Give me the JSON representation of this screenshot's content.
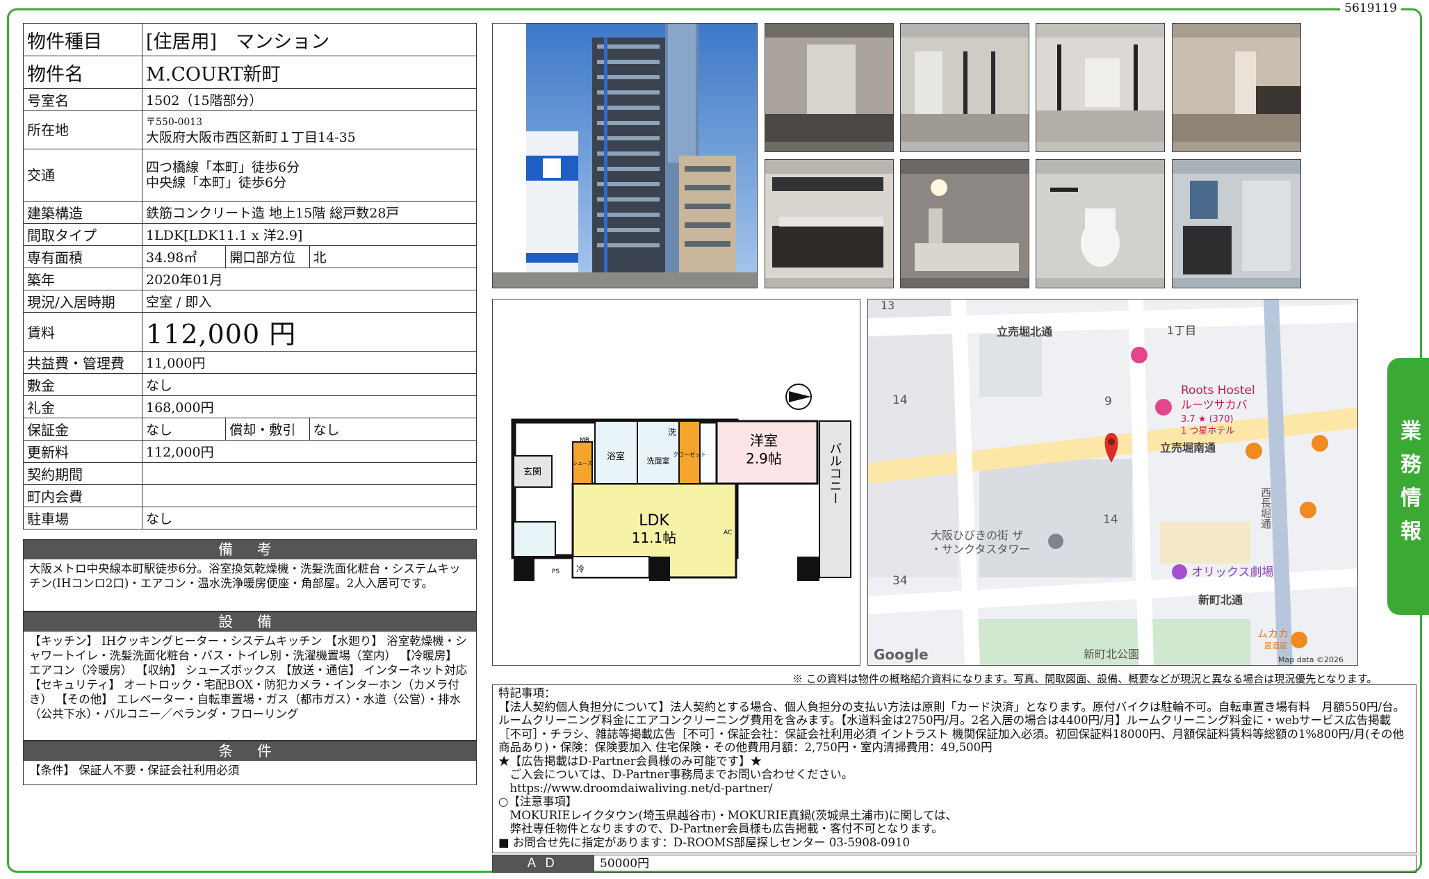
{
  "doc_id": "5619119",
  "side_tab": "業務情報",
  "property": {
    "type_label": "物件種目",
    "type_value": "[住居用]　マンション",
    "name_label": "物件名",
    "name_value": "M.COURT新町",
    "room_label": "号室名",
    "room_value": "1502（15階部分）",
    "address_label": "所在地",
    "postal": "〒550-0013",
    "address_value": "大阪府大阪市西区新町１丁目14-35",
    "access_label": "交通",
    "access_line1": "四つ橋線「本町」徒歩6分",
    "access_line2": "中央線「本町」徒歩6分",
    "structure_label": "建築構造",
    "structure_value": "鉄筋コンクリート造 地上15階 総戸数28戸",
    "layout_label": "間取タイプ",
    "layout_value": "1LDK[LDK11.1 x 洋2.9]",
    "area_label": "専有面積",
    "area_value": "34.98㎡",
    "direction_label": "開口部方位",
    "direction_value": "北",
    "built_label": "築年",
    "built_value": "2020年01月",
    "status_label": "現況/入居時期",
    "status_value": "空室 / 即入",
    "rent_label": "賃料",
    "rent_value": "112,000 円",
    "fee_label": "共益費・管理費",
    "fee_value": "11,000円",
    "deposit_label": "敷金",
    "deposit_value": "なし",
    "keymoney_label": "礼金",
    "keymoney_value": "168,000円",
    "guarantee_label": "保証金",
    "guarantee_value": "なし",
    "amort_label": "償却・敷引",
    "amort_value": "なし",
    "renewal_label": "更新料",
    "renewal_value": "112,000円",
    "contract_label": "契約期間",
    "contract_value": "",
    "town_fee_label": "町内会費",
    "town_fee_value": "",
    "parking_label": "駐車場",
    "parking_value": "なし"
  },
  "remarks": {
    "title": "備 考",
    "text": "大阪メトロ中央線本町駅徒歩6分。浴室換気乾燥機・洗髪洗面化粧台・システムキッチン(IHコンロ2口)・エアコン・温水洗浄暖房便座・角部屋。2人入居可です。"
  },
  "equipment": {
    "title": "設 備",
    "text": "【キッチン】 IHクッキングヒーター・システムキッチン 【水廻り】 浴室乾燥機・シャワートイレ・洗髪洗面化粧台・バス・トイレ別・洗濯機置場（室内） 【冷暖房】 エアコン（冷暖房） 【収納】 シューズボックス 【放送・通信】 インターネット対応 【セキュリティ】 オートロック・宅配BOX・防犯カメラ・インターホン（カメラ付き） 【その他】 エレベーター・自転車置場・ガス（都市ガス）・水道（公営）・排水（公共下水）・バルコニー／ベランダ・フローリング"
  },
  "conditions": {
    "title": "条 件",
    "text": "【条件】 保証人不要・保証会社利用必須"
  },
  "floorplan": {
    "room_western": "洋室",
    "room_western_size": "2.9帖",
    "ldk": "LDK",
    "ldk_size": "11.1帖",
    "balcony": "バルコニー",
    "entrance": "玄関",
    "bath": "浴室",
    "washroom": "洗面室",
    "closet": "クローゼット",
    "shoe": "シューズ",
    "ac": "AC",
    "mb": "MB",
    "ps": "PS",
    "wash_mark": "洗",
    "cold": "冷"
  },
  "map": {
    "labels": {
      "n13": "13",
      "n14a": "14",
      "n9": "9",
      "n14b": "14",
      "n34": "34",
      "street1": "立売堀北通",
      "chome": "1丁目",
      "street2": "立売堀南通",
      "street3": "新町北通",
      "hostel": "Roots Hostel",
      "hostel_jp": "ルーツサカバ",
      "hostel_rating": "3.7 ★ (370)",
      "hostel_type": "1 つ星ホテル",
      "tower1": "大阪ひびきの街 ザ",
      "tower2": "・サンクタスタワー",
      "theater": "オリックス劇場",
      "park": "新町北公園",
      "avenue": "西長堀通",
      "izakaya": "ムカカ",
      "izakaya_type": "居酒屋",
      "google": "Google",
      "mapdata": "Map data ©2026"
    }
  },
  "notice": "※ この資料は物件の概略紹介資料になります。写真、間取図面、設備、概要などが現況と異なる場合は現況優先となります。",
  "notes": {
    "lines": [
      "特記事項：",
      "【法人契約個人負担分について】法人契約とする場合、個人負担分の支払い方法は原則「カード決済」となります。原付バイクは駐輪不可。自転車置き場有料　月額550円/台。ルームクリーニング料金にエアコンクリーニング費用を含みます。【水道料金は2750円/月。2名入居の場合は4400円/月】ルームクリーニング料金に・webサービス広告掲載［不可］・チラシ、雑誌等掲載広告［不可］・保証会社：保証会社利用必須 イントラスト 機関保証加入必須。初回保証料18000円、月額保証料賃料等総額の1%800円/月(その他商品あり)・保険：保険要加入 住宅保険・その他費用月額：2,750円・室内清掃費用：49,500円",
      "★【広告掲載はD-Partner会員様のみ可能です】★",
      "　ご入会については、D-Partner事務局までお問い合わせください。",
      "　https://www.droomdaiwaliving.net/d-partner/",
      "○【注意事項】",
      "　MOKURIEレイクタウン(埼玉県越谷市)・MOKURIE真鍋(茨城県土浦市)に関しては、",
      "　弊社専任物件となりますので、D-Partner会員様も広告掲載・客付不可となります。",
      "■ お問合せ先に指定があります：D-ROOMS部屋探しセンター 03-5908-0910"
    ]
  },
  "ad": {
    "label": "ＡＤ",
    "value": "50000円"
  }
}
